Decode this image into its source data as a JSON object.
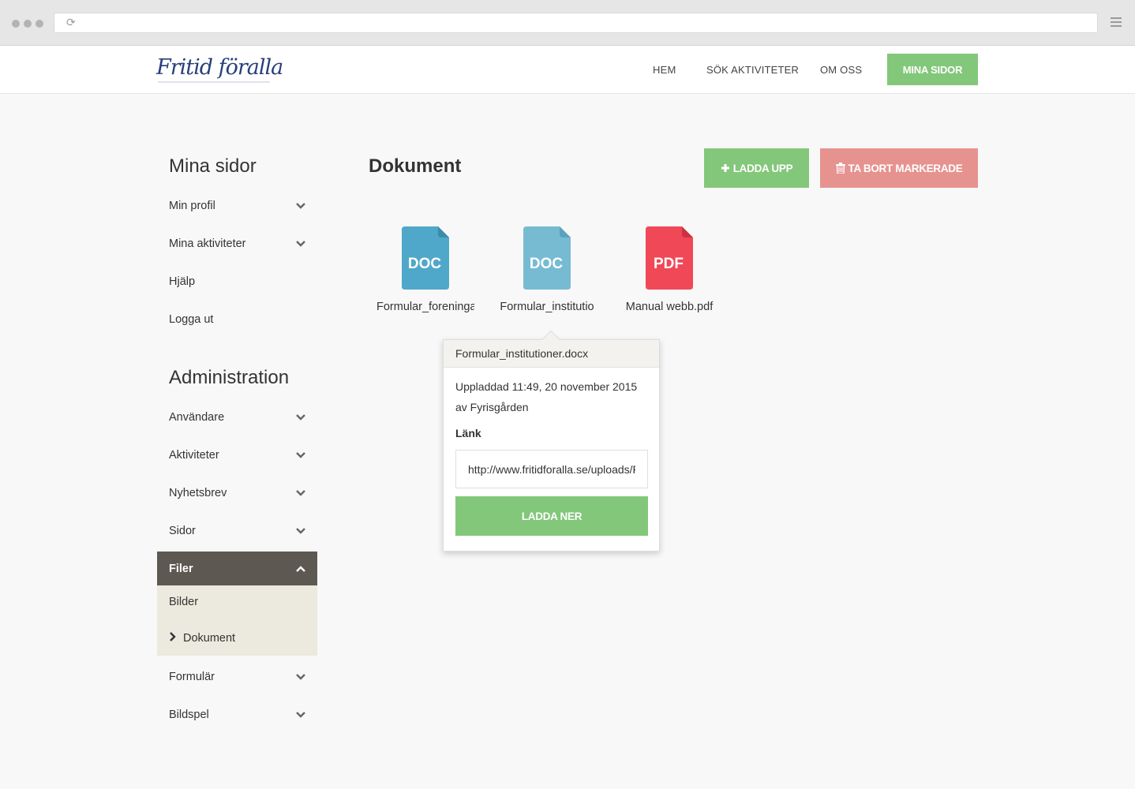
{
  "browser": {
    "reload_icon": "reload-icon",
    "menu_icon": "hamburger-icon"
  },
  "header": {
    "logo_text": "Fritid föralla",
    "nav": {
      "home": "HEM",
      "search": "SÖK AKTIVITETER",
      "about": "OM OSS",
      "mine": "MINA SIDOR"
    }
  },
  "sidebar": {
    "mina_sidor_heading": "Mina sidor",
    "mina_items": [
      {
        "label": "Min profil",
        "expandable": true
      },
      {
        "label": "Mina aktiviteter",
        "expandable": true
      },
      {
        "label": "Hjälp",
        "expandable": false
      },
      {
        "label": "Logga ut",
        "expandable": false
      }
    ],
    "admin_heading": "Administration",
    "admin_items": [
      {
        "label": "Användare",
        "expandable": true
      },
      {
        "label": "Aktiviteter",
        "expandable": true
      },
      {
        "label": "Nyhetsbrev",
        "expandable": true
      },
      {
        "label": "Sidor",
        "expandable": true
      },
      {
        "label": "Filer",
        "expandable": true,
        "expanded": true
      },
      {
        "label": "Formulär",
        "expandable": true
      },
      {
        "label": "Bildspel",
        "expandable": true
      }
    ],
    "files_sub": [
      {
        "label": "Bilder",
        "current": false
      },
      {
        "label": "Dokument",
        "current": true
      }
    ]
  },
  "main": {
    "title": "Dokument",
    "upload_label": "LADDA UPP",
    "delete_label": "TA BORT MARKERADE",
    "files": [
      {
        "name": "Formular_foreninga",
        "type": "DOC",
        "color": "#4fa8c9"
      },
      {
        "name": "Formular_institutio",
        "type": "DOC",
        "color": "#77bbd3"
      },
      {
        "name": "Manual webb.pdf",
        "type": "PDF",
        "color": "#f04856"
      }
    ]
  },
  "popover": {
    "filename": "Formular_institutioner.docx",
    "uploaded": "Uppladdad 11:49, 20 november 2015",
    "by": "av Fyrisgården",
    "link_label": "Länk",
    "link_value": "http://www.fritidforalla.se/uploads/Formular_institutioner.docx",
    "download_label": "LADDA NER"
  },
  "colors": {
    "green": "#83c77a",
    "red": "#e69390",
    "active_sidebar": "#5e5852",
    "sub_bg": "#ece9de",
    "logo": "#27407a"
  }
}
